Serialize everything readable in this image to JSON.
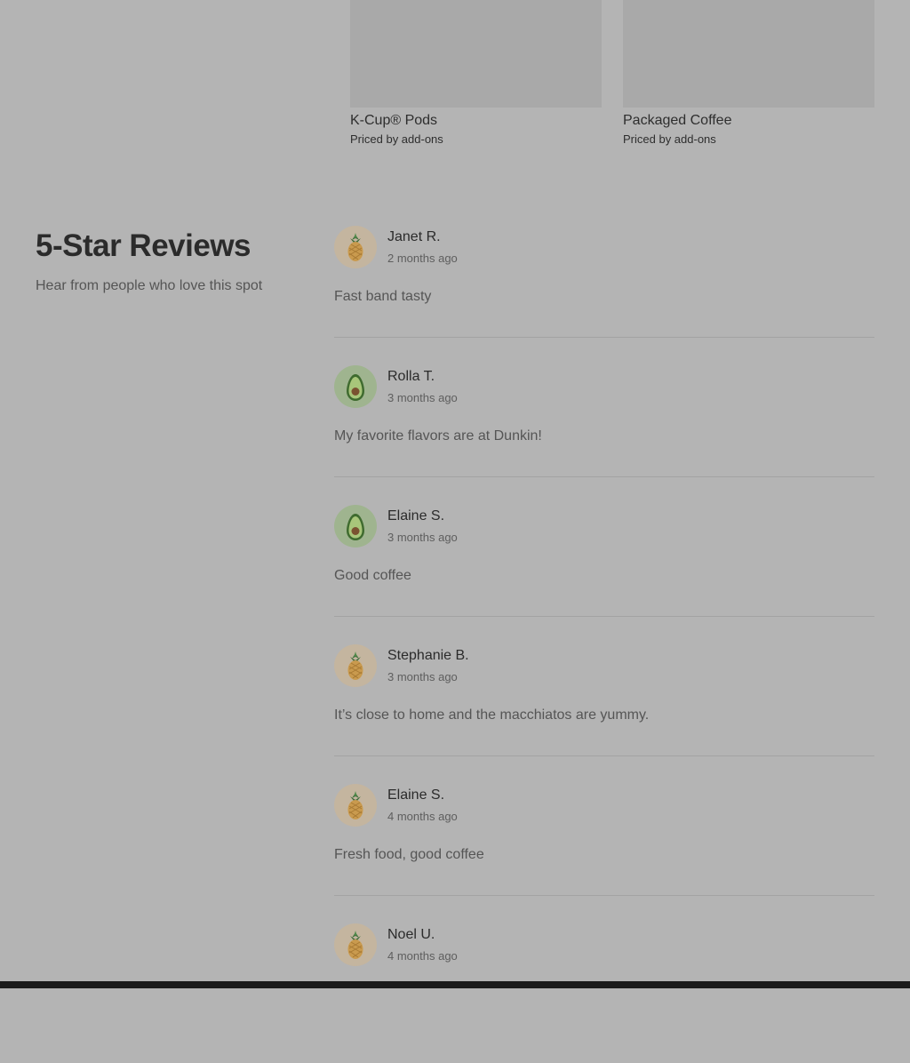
{
  "products": [
    {
      "name": "K-Cup® Pods",
      "price": "Priced by add-ons"
    },
    {
      "name": "Packaged Coffee",
      "price": "Priced by add-ons"
    }
  ],
  "reviews_section": {
    "title": "5-Star Reviews",
    "subtitle": "Hear from people who love this spot"
  },
  "reviews": [
    {
      "name": "Janet R.",
      "ago": "2 months ago",
      "text": "Fast band tasty",
      "avatar": "pineapple-icon"
    },
    {
      "name": "Rolla T.",
      "ago": "3 months ago",
      "text": "My favorite flavors are at Dunkin!",
      "avatar": "avocado-icon"
    },
    {
      "name": "Elaine S.",
      "ago": "3 months ago",
      "text": "Good coffee",
      "avatar": "avocado-icon"
    },
    {
      "name": "Stephanie B.",
      "ago": "3 months ago",
      "text": "It’s close to home and the macchiatos are yummy.",
      "avatar": "pineapple-icon"
    },
    {
      "name": "Elaine S.",
      "ago": "4 months ago",
      "text": "Fresh food, good coffee",
      "avatar": "pineapple-icon"
    },
    {
      "name": "Noel U.",
      "ago": "4 months ago",
      "text": "",
      "avatar": "pineapple-icon"
    }
  ]
}
